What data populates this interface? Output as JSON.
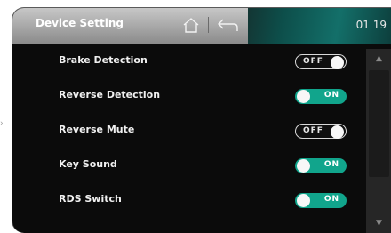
{
  "header": {
    "title": "Device Setting",
    "clock": "01 19",
    "home_icon": "home-icon",
    "back_icon": "back-icon"
  },
  "settings": [
    {
      "label": "Brake Detection",
      "state": "OFF"
    },
    {
      "label": "Reverse Detection",
      "state": "ON"
    },
    {
      "label": "Reverse Mute",
      "state": "OFF"
    },
    {
      "label": "Key Sound",
      "state": "ON"
    },
    {
      "label": "RDS Switch",
      "state": "ON"
    }
  ],
  "scrollbar": {
    "up": "▲",
    "down": "▼"
  },
  "colors": {
    "toggle_on": "#11a58c",
    "accent_band": "#136f69"
  }
}
